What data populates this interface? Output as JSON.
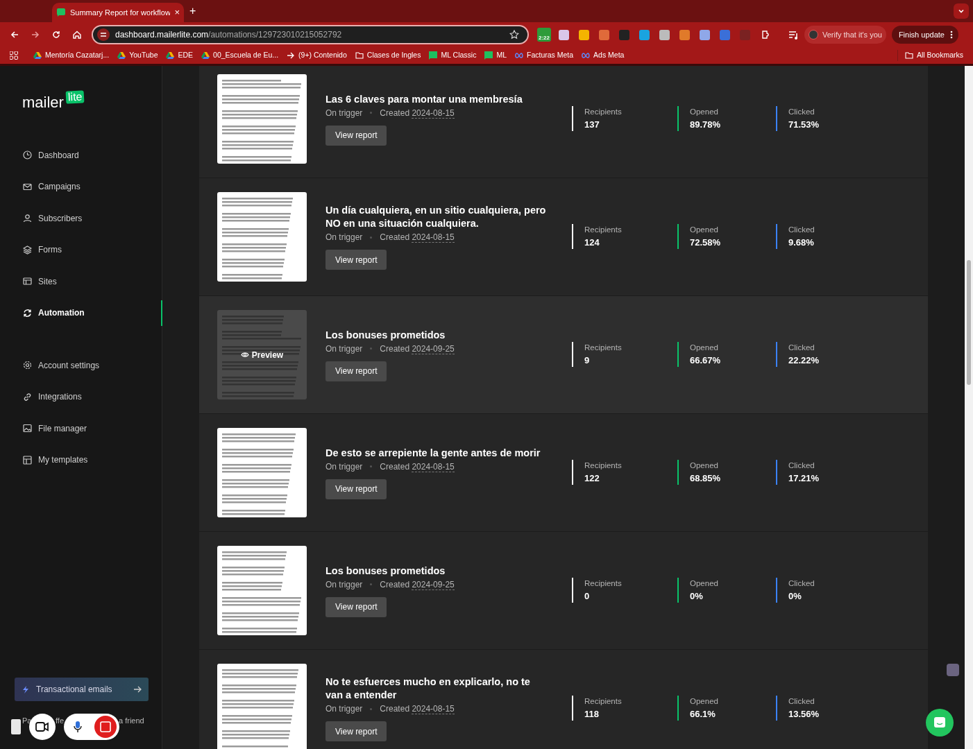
{
  "browser": {
    "tab": {
      "title": "Summary Report for workflow",
      "close": "×",
      "selected": true
    },
    "new_tab": "+",
    "url": {
      "domain": "dashboard.mailerlite.com",
      "path": "/automations/129723010215052792"
    },
    "extension_badge": "2:22",
    "profile_chip": "Verify that it's you",
    "update_button": "Finish update",
    "bookmarks": [
      {
        "label": "Mentoría Cazatarj...",
        "kind": "drive"
      },
      {
        "label": "YouTube",
        "kind": "drive"
      },
      {
        "label": "EDE",
        "kind": "drive"
      },
      {
        "label": "00_Escuela de Eu...",
        "kind": "drive"
      },
      {
        "label": "(9+) Contenido",
        "kind": "arrow"
      },
      {
        "label": "Clases de Ingles",
        "kind": "folder"
      },
      {
        "label": "ML Classic",
        "kind": "flag"
      },
      {
        "label": "ML",
        "kind": "flag"
      },
      {
        "label": "Facturas Meta",
        "kind": "meta"
      },
      {
        "label": "Ads Meta",
        "kind": "meta"
      }
    ],
    "all_bookmarks": "All Bookmarks"
  },
  "sidebar": {
    "logo": {
      "text": "mailer",
      "badge": "lite"
    },
    "items": [
      {
        "label": "Dashboard",
        "selected": false
      },
      {
        "label": "Campaigns",
        "selected": false
      },
      {
        "label": "Subscribers",
        "selected": false
      },
      {
        "label": "Forms",
        "selected": false
      },
      {
        "label": "Sites",
        "selected": false
      },
      {
        "label": "Automation",
        "selected": true
      }
    ],
    "secondary_items": [
      {
        "label": "Account settings",
        "selected": false
      },
      {
        "label": "Integrations",
        "selected": false
      },
      {
        "label": "File manager",
        "selected": false
      },
      {
        "label": "My templates",
        "selected": false
      }
    ],
    "promo_button": "Transactional emails",
    "referral_fragments": [
      "Pa",
      "ffe",
      "a friend"
    ]
  },
  "emails": [
    {
      "title": "Las 6 claves para montar una membresía",
      "trigger": "On trigger",
      "created_label": "Created",
      "date": "2024-08-15",
      "hovered": false,
      "button": "View report",
      "stats": [
        {
          "label": "Recipients",
          "value": "137"
        },
        {
          "label": "Opened",
          "value": "89.78%"
        },
        {
          "label": "Clicked",
          "value": "71.53%"
        }
      ]
    },
    {
      "title": "Un día cualquiera, en un sitio cualquiera, pero NO en una situación cualquiera.",
      "trigger": "On trigger",
      "created_label": "Created",
      "date": "2024-08-15",
      "hovered": false,
      "button": "View report",
      "stats": [
        {
          "label": "Recipients",
          "value": "124"
        },
        {
          "label": "Opened",
          "value": "72.58%"
        },
        {
          "label": "Clicked",
          "value": "9.68%"
        }
      ]
    },
    {
      "title": "Los bonuses prometidos",
      "trigger": "On trigger",
      "created_label": "Created",
      "date": "2024-09-25",
      "hovered": true,
      "preview_label": "Preview",
      "button": "View report",
      "stats": [
        {
          "label": "Recipients",
          "value": "9"
        },
        {
          "label": "Opened",
          "value": "66.67%"
        },
        {
          "label": "Clicked",
          "value": "22.22%"
        }
      ]
    },
    {
      "title": "De esto se arrepiente la gente antes de morir",
      "trigger": "On trigger",
      "created_label": "Created",
      "date": "2024-08-15",
      "hovered": false,
      "button": "View report",
      "stats": [
        {
          "label": "Recipients",
          "value": "122"
        },
        {
          "label": "Opened",
          "value": "68.85%"
        },
        {
          "label": "Clicked",
          "value": "17.21%"
        }
      ]
    },
    {
      "title": "Los bonuses prometidos",
      "trigger": "On trigger",
      "created_label": "Created",
      "date": "2024-09-25",
      "hovered": false,
      "button": "View report",
      "stats": [
        {
          "label": "Recipients",
          "value": "0"
        },
        {
          "label": "Opened",
          "value": "0%"
        },
        {
          "label": "Clicked",
          "value": "0%"
        }
      ]
    },
    {
      "title": "No te esfuerces mucho en explicarlo, no te van a entender",
      "trigger": "On trigger",
      "created_label": "Created",
      "date": "2024-08-15",
      "hovered": false,
      "button": "View report",
      "stats": [
        {
          "label": "Recipients",
          "value": "118"
        },
        {
          "label": "Opened",
          "value": "66.1%"
        },
        {
          "label": "Clicked",
          "value": "13.56%"
        }
      ]
    }
  ]
}
